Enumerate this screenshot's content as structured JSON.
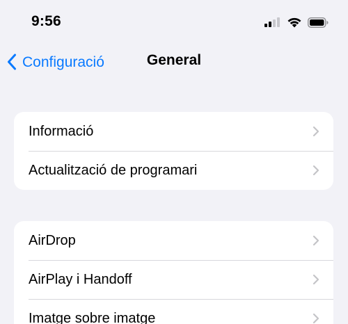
{
  "status_bar": {
    "time": "9:56",
    "icons": [
      "cellular-signal-icon",
      "wifi-icon",
      "battery-icon"
    ]
  },
  "nav": {
    "back_label": "Configuració",
    "back_icon": "chevron-left-icon",
    "title": "General"
  },
  "groups": [
    {
      "items": [
        {
          "label": "Informació",
          "icon": "chevron-right-icon"
        },
        {
          "label": "Actualització de programari",
          "icon": "chevron-right-icon"
        }
      ]
    },
    {
      "items": [
        {
          "label": "AirDrop",
          "icon": "chevron-right-icon"
        },
        {
          "label": "AirPlay i Handoff",
          "icon": "chevron-right-icon"
        },
        {
          "label": "Imatge sobre imatge",
          "icon": "chevron-right-icon"
        }
      ]
    }
  ],
  "colors": {
    "background": "#F2F2F7",
    "accent": "#0A7AFF",
    "cell": "#FFFFFF",
    "separator": "#D7D7DC",
    "chevron": "#C4C4C7"
  }
}
